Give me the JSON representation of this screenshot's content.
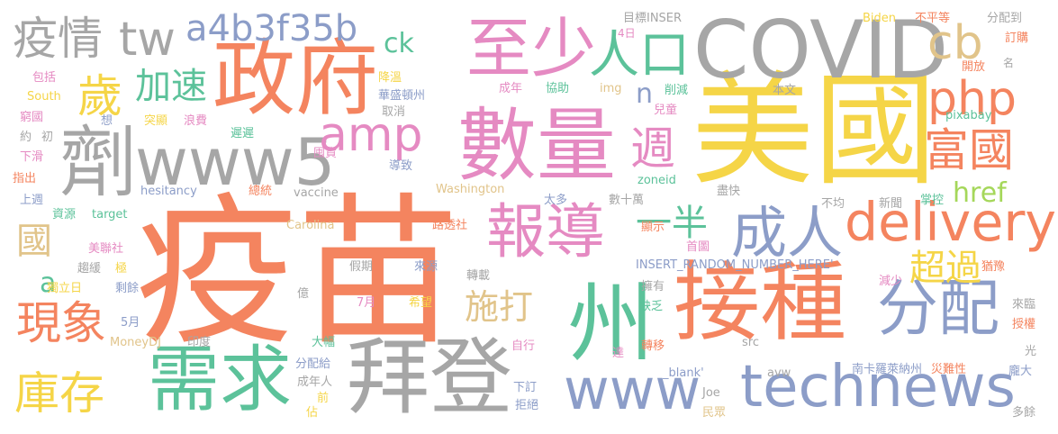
{
  "palette": {
    "orange": "#F4845F",
    "gold": "#F5D547",
    "gray": "#A6A6A6",
    "blue": "#8C9DC8",
    "pink": "#E58AC2",
    "green": "#5CC29A",
    "tan": "#E1C48A",
    "lime": "#A5D75A"
  },
  "words": [
    {
      "text": "疫苗",
      "color": "orange"
    },
    {
      "text": "美國",
      "color": "gold"
    },
    {
      "text": "州",
      "color": "green"
    },
    {
      "text": "接種",
      "color": "orange"
    },
    {
      "text": "數量",
      "color": "pink"
    },
    {
      "text": "COVID",
      "color": "gray"
    },
    {
      "text": "政府",
      "color": "orange"
    },
    {
      "text": "拜登",
      "color": "gray"
    },
    {
      "text": "需求",
      "color": "green"
    },
    {
      "text": "報導",
      "color": "pink"
    },
    {
      "text": "劑",
      "color": "gray"
    },
    {
      "text": "www5",
      "color": "gray"
    },
    {
      "text": "至少",
      "color": "pink"
    },
    {
      "text": "technews",
      "color": "blue"
    },
    {
      "text": "www",
      "color": "blue"
    },
    {
      "text": "分配",
      "color": "blue"
    },
    {
      "text": "成人",
      "color": "blue"
    },
    {
      "text": "delivery",
      "color": "orange"
    },
    {
      "text": "疫情",
      "color": "gray"
    },
    {
      "text": "tw",
      "color": "gray"
    },
    {
      "text": "a4b3f35b",
      "color": "blue"
    },
    {
      "text": "人口",
      "color": "green"
    },
    {
      "text": "cb",
      "color": "tan"
    },
    {
      "text": "amp",
      "color": "pink"
    },
    {
      "text": "php",
      "color": "orange"
    },
    {
      "text": "富國",
      "color": "orange"
    },
    {
      "text": "歲",
      "color": "gold"
    },
    {
      "text": "加速",
      "color": "green"
    },
    {
      "text": "週",
      "color": "pink"
    },
    {
      "text": "現象",
      "color": "orange"
    },
    {
      "text": "庫存",
      "color": "gold"
    },
    {
      "text": "一半",
      "color": "green"
    },
    {
      "text": "超過",
      "color": "gold"
    },
    {
      "text": "施打",
      "color": "tan"
    },
    {
      "text": "href",
      "color": "lime"
    },
    {
      "text": "國",
      "color": "tan"
    },
    {
      "text": "ck",
      "color": "green"
    },
    {
      "text": "n",
      "color": "blue"
    },
    {
      "text": "a",
      "color": "green"
    },
    {
      "text": "目標INSER",
      "color": "gray"
    },
    {
      "text": "4日",
      "color": "pink"
    },
    {
      "text": "Biden",
      "color": "gold"
    },
    {
      "text": "不平等",
      "color": "orange"
    },
    {
      "text": "分配到",
      "color": "gray"
    },
    {
      "text": "訂購",
      "color": "orange"
    },
    {
      "text": "開放",
      "color": "orange"
    },
    {
      "text": "名",
      "color": "gray"
    },
    {
      "text": "包括",
      "color": "pink"
    },
    {
      "text": "South",
      "color": "gold"
    },
    {
      "text": "窮國",
      "color": "pink"
    },
    {
      "text": "約",
      "color": "gray"
    },
    {
      "text": "初",
      "color": "gray"
    },
    {
      "text": "下滑",
      "color": "pink"
    },
    {
      "text": "指出",
      "color": "orange"
    },
    {
      "text": "上週",
      "color": "blue"
    },
    {
      "text": "資源",
      "color": "green"
    },
    {
      "text": "target",
      "color": "green"
    },
    {
      "text": "降溫",
      "color": "gold"
    },
    {
      "text": "華盛頓州",
      "color": "blue"
    },
    {
      "text": "成年",
      "color": "pink"
    },
    {
      "text": "協助",
      "color": "green"
    },
    {
      "text": "img",
      "color": "tan"
    },
    {
      "text": "削減",
      "color": "green"
    },
    {
      "text": "本文",
      "color": "gray"
    },
    {
      "text": "想",
      "color": "blue"
    },
    {
      "text": "突顯",
      "color": "gold"
    },
    {
      "text": "浪費",
      "color": "pink"
    },
    {
      "text": "遲遲",
      "color": "green"
    },
    {
      "text": "取消",
      "color": "gray"
    },
    {
      "text": "兒童",
      "color": "pink"
    },
    {
      "text": "pixabay",
      "color": "green"
    },
    {
      "text": "囤貨",
      "color": "pink"
    },
    {
      "text": "導致",
      "color": "blue"
    },
    {
      "text": "hesitancy",
      "color": "blue"
    },
    {
      "text": "總統",
      "color": "orange"
    },
    {
      "text": "vaccine",
      "color": "gray"
    },
    {
      "text": "Washington",
      "color": "tan"
    },
    {
      "text": "zoneid",
      "color": "green"
    },
    {
      "text": "太多",
      "color": "blue"
    },
    {
      "text": "數十萬",
      "color": "gray"
    },
    {
      "text": "盡快",
      "color": "gray"
    },
    {
      "text": "不均",
      "color": "gray"
    },
    {
      "text": "新聞",
      "color": "gray"
    },
    {
      "text": "掌控",
      "color": "green"
    },
    {
      "text": "Carolina",
      "color": "tan"
    },
    {
      "text": "路透社",
      "color": "orange"
    },
    {
      "text": "顯示",
      "color": "orange"
    },
    {
      "text": "首圖",
      "color": "pink"
    },
    {
      "text": "美聯社",
      "color": "pink"
    },
    {
      "text": "趨緩",
      "color": "gray"
    },
    {
      "text": "極",
      "color": "gold"
    },
    {
      "text": "獨立日",
      "color": "gold"
    },
    {
      "text": "剩餘",
      "color": "blue"
    },
    {
      "text": "假期",
      "color": "gray"
    },
    {
      "text": "來源",
      "color": "blue"
    },
    {
      "text": "轉載",
      "color": "gray"
    },
    {
      "text": "INSERT_RANDOM_NUMBER_HERE'",
      "color": "blue"
    },
    {
      "text": "猶豫",
      "color": "orange"
    },
    {
      "text": "擁有",
      "color": "gray"
    },
    {
      "text": "減少",
      "color": "pink"
    },
    {
      "text": "來臨",
      "color": "gray"
    },
    {
      "text": "7月",
      "color": "pink"
    },
    {
      "text": "希望",
      "color": "gold"
    },
    {
      "text": "缺乏",
      "color": "green"
    },
    {
      "text": "授權",
      "color": "orange"
    },
    {
      "text": "億",
      "color": "gray"
    },
    {
      "text": "5月",
      "color": "blue"
    },
    {
      "text": "MoneyDJ",
      "color": "tan"
    },
    {
      "text": "印度",
      "color": "gray"
    },
    {
      "text": "大幅",
      "color": "green"
    },
    {
      "text": "自行",
      "color": "pink"
    },
    {
      "text": "達",
      "color": "pink"
    },
    {
      "text": "轉移",
      "color": "orange"
    },
    {
      "text": "光",
      "color": "gray"
    },
    {
      "text": "src",
      "color": "gray"
    },
    {
      "text": "分配給",
      "color": "blue"
    },
    {
      "text": "成年人",
      "color": "gray"
    },
    {
      "text": "_blank'",
      "color": "blue"
    },
    {
      "text": "avw",
      "color": "gray"
    },
    {
      "text": "南卡羅萊納州",
      "color": "blue"
    },
    {
      "text": "災難性",
      "color": "orange"
    },
    {
      "text": "龐大",
      "color": "blue"
    },
    {
      "text": "前",
      "color": "gold"
    },
    {
      "text": "佔",
      "color": "gold"
    },
    {
      "text": "下訂",
      "color": "blue"
    },
    {
      "text": "拒絕",
      "color": "blue"
    },
    {
      "text": "Joe",
      "color": "gray"
    },
    {
      "text": "民眾",
      "color": "tan"
    },
    {
      "text": "多餘",
      "color": "gray"
    }
  ]
}
